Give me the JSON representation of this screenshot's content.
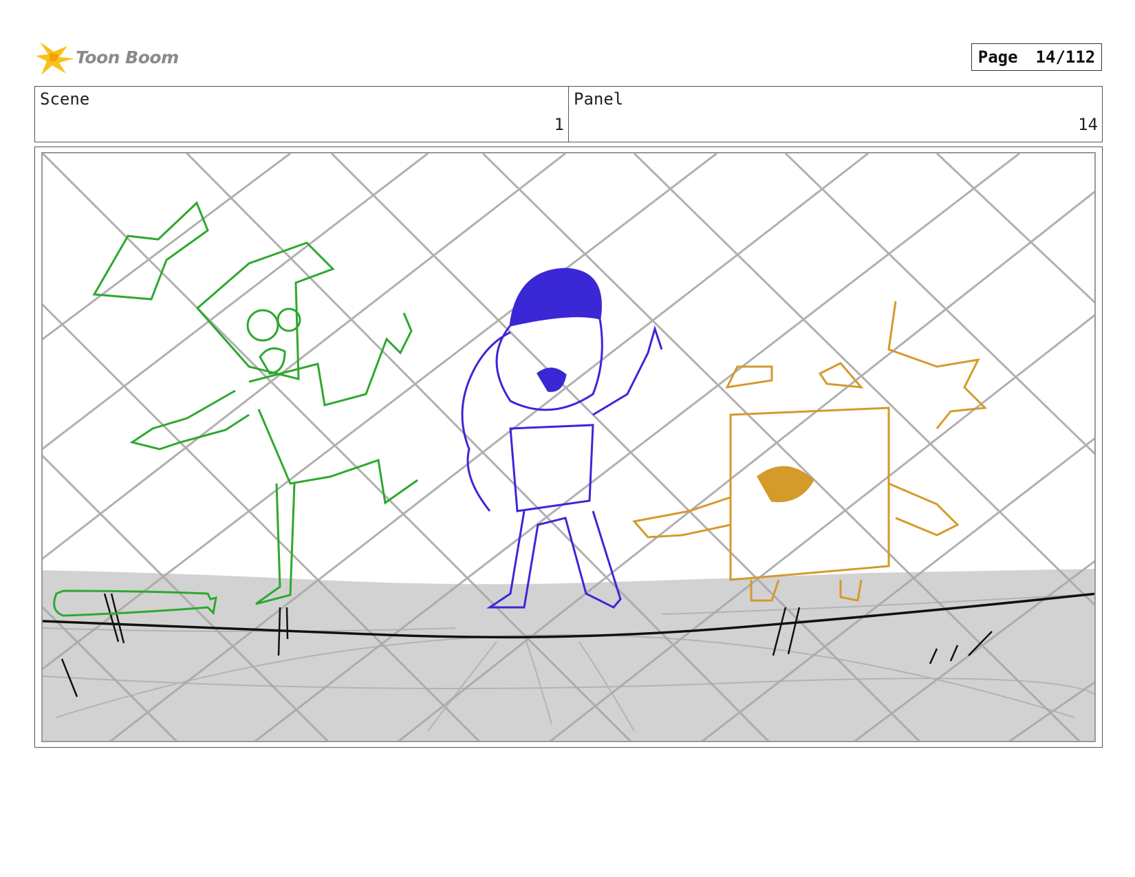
{
  "header": {
    "logo_text": "Toon Boom",
    "page_label": "Page",
    "page_number": "14/112"
  },
  "info": {
    "scene_label": "Scene",
    "scene_value": "1",
    "panel_label": "Panel",
    "panel_value": "14"
  },
  "colors": {
    "character_left": "#2ea82e",
    "character_center": "#3a27d6",
    "character_right": "#d49a2a",
    "ground": "#d2d2d2",
    "fence": "#a8a8a8",
    "logo_star": "#f7c21b"
  },
  "drawing": {
    "subject_icons": [
      "chain-link-fence",
      "green-boy-character",
      "blue-girl-character",
      "orange-box-character",
      "baseball-bat"
    ]
  }
}
